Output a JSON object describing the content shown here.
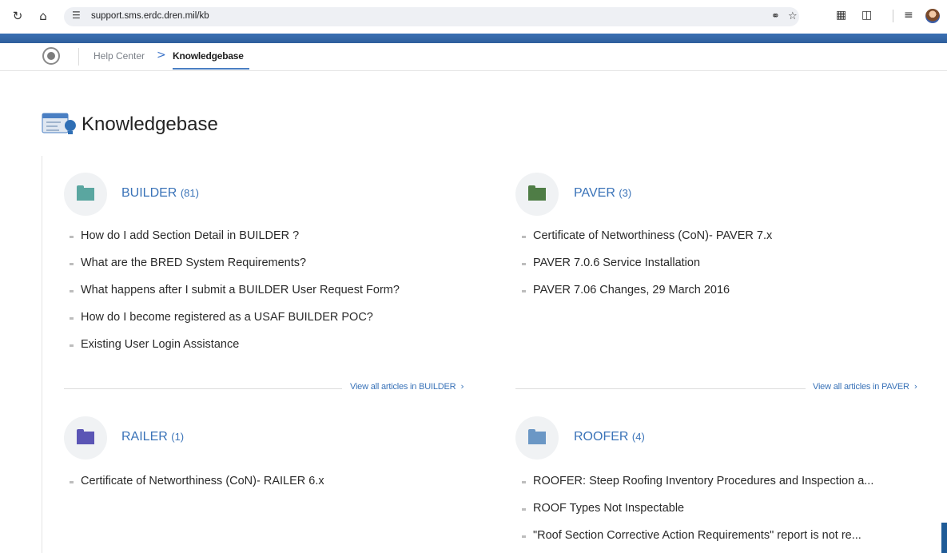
{
  "browser": {
    "url": "support.sms.erdc.dren.mil/kb",
    "icons": {
      "reload": "reload-icon",
      "home": "home-icon",
      "site_info": "site-info-icon",
      "password": "password-key-icon",
      "bookmark": "star-icon",
      "extension_a": "extension-icon",
      "extensions": "puzzle-icon",
      "reading_list": "reading-list-icon",
      "profile": "profile-avatar"
    }
  },
  "header": {
    "breadcrumb": {
      "help_center": "Help Center",
      "separator": ">",
      "current": "Knowledgebase"
    }
  },
  "page": {
    "title": "Knowledgebase"
  },
  "categories": [
    {
      "name": "BUILDER",
      "count": "(81)",
      "folder_color": "#5aa6a0",
      "articles": [
        "How do I add Section Detail in BUILDER ?",
        "What are the BRED System Requirements?",
        "What happens after I submit a BUILDER User Request Form?",
        "How do I become registered as a USAF BUILDER POC?",
        "Existing User Login Assistance"
      ],
      "view_all": "View all articles in BUILDER"
    },
    {
      "name": "PAVER",
      "count": "(3)",
      "folder_color": "#4f7d46",
      "articles": [
        "Certificate of Networthiness (CoN)- PAVER 7.x",
        "PAVER 7.0.6 Service Installation",
        "PAVER 7.06 Changes, 29 March 2016"
      ],
      "view_all": "View all articles in PAVER"
    },
    {
      "name": "RAILER",
      "count": "(1)",
      "folder_color": "#5b55b5",
      "articles": [
        "Certificate of Networthiness (CoN)- RAILER 6.x"
      ]
    },
    {
      "name": "ROOFER",
      "count": "(4)",
      "folder_color": "#6b97c5",
      "articles": [
        "ROOFER: Steep Roofing Inventory Procedures and Inspection a...",
        "ROOF Types Not Inspectable",
        "\"Roof Section Corrective Action Requirements\" report is not re..."
      ]
    }
  ]
}
